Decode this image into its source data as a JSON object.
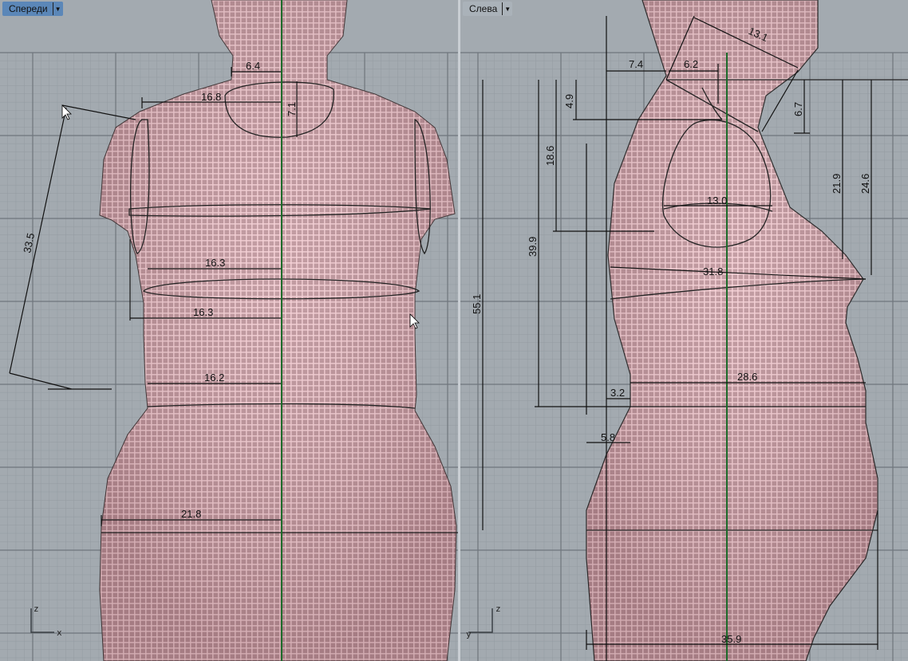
{
  "viewports": {
    "front": {
      "title": "Спереди",
      "axis_labels": {
        "vertical": "z",
        "horizontal": "x"
      }
    },
    "side": {
      "title": "Слева",
      "axis_labels": {
        "vertical": "z",
        "horizontal": "y"
      }
    }
  },
  "dimensions": {
    "front": {
      "neck_half_width": "6.4",
      "shoulder_half_width": "16.8",
      "neck_depth": "7.1",
      "arm_length": "33.5",
      "chest_half_width": "16.3",
      "bust_half_width": "16.3",
      "waist_half_width": "16.2",
      "hip_half_width": "21.8"
    },
    "side": {
      "neck_slant": "13.1",
      "neck_front_offset": "7.4",
      "neck_depth": "6.2",
      "collar_drop": "4.9",
      "back_neck_drop": "6.7",
      "armhole_height": "18.6",
      "armhole_width": "13.0",
      "shoulder_to_bust_back": "21.9",
      "shoulder_to_bust": "24.6",
      "shoulder_to_waist": "39.9",
      "bust_depth": "31.8",
      "shoulder_to_hip": "55.1",
      "waist_depth": "28.6",
      "waist_offset": "3.2",
      "front_offset": "5.8",
      "hip_depth": "35.9"
    }
  },
  "colors": {
    "viewport_bg": "#a3aab0",
    "active_tab": "#5b87b8",
    "mesh": "#f3c5cb",
    "axis_green": "#1d6b2a"
  }
}
